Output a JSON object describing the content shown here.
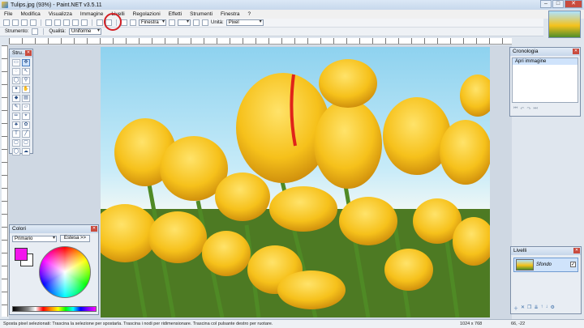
{
  "window": {
    "title": "Tulips.jpg (93%) - Paint.NET v3.5.11",
    "controls": [
      "–",
      "□",
      "✕"
    ]
  },
  "menu": [
    "File",
    "Modifica",
    "Visualizza",
    "Immagine",
    "Livelli",
    "Regolazioni",
    "Effetti",
    "Strumenti",
    "Finestra",
    "?"
  ],
  "toolbar": {
    "window_select": "Finestra",
    "unit_label": "Unità:",
    "unit_value": "Pixel"
  },
  "toolbar2": {
    "tool_label": "Strumento:",
    "quality_label": "Qualità:",
    "quality_value": "Uniforme"
  },
  "tools_panel": {
    "title": "Stru..."
  },
  "history_panel": {
    "title": "Cronologia",
    "items": [
      "Apri immagine"
    ]
  },
  "colors_panel": {
    "title": "Colori",
    "mode": "Primario",
    "more_button": "Estesa >>",
    "primary_color": "#f315ec",
    "secondary_color": "#ffffff"
  },
  "layers_panel": {
    "title": "Livelli",
    "layers": [
      {
        "name": "Sfondo",
        "visible": true
      }
    ]
  },
  "status": {
    "text": "Sposta pixel selezionati: Trascina la selezione per spostarla. Trascina i nodi per ridimensionare. Trascina col pulsante destro per ruotare.",
    "size": "1024 x 768",
    "coords": "66, -22"
  }
}
